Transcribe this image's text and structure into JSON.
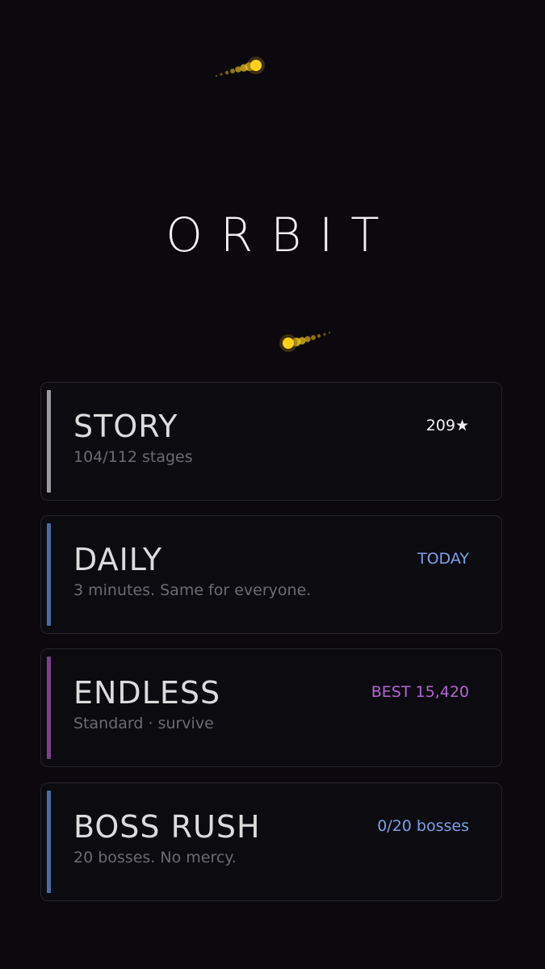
{
  "game": {
    "title": "ORBIT"
  },
  "colors": {
    "background": "#0b080e",
    "comet": "#ffd21a",
    "story_accent": "#9a9aa0",
    "daily_accent": "#4e6aa6",
    "endless_accent": "#7e3f90",
    "boss_accent": "#4e6aa6",
    "daily_stat": "#7e9fe6",
    "endless_stat": "#b464d2",
    "boss_stat": "#7e9fe6"
  },
  "modes": [
    {
      "name": "STORY",
      "description": "104/112 stages",
      "stat": "209★",
      "stat_color": "#f2f2f2",
      "accent_color": "#9a9aa0"
    },
    {
      "name": "DAILY",
      "description": "3 minutes. Same for everyone.",
      "stat": "TODAY",
      "stat_color": "#7e9fe6",
      "accent_color": "#4e6aa6"
    },
    {
      "name": "ENDLESS",
      "description": "Standard · survive",
      "stat": "BEST 15,420",
      "stat_color": "#b464d2",
      "accent_color": "#7e3f90"
    },
    {
      "name": "BOSS RUSH",
      "description": "20 bosses. No mercy.",
      "stat": "0/20 bosses",
      "stat_color": "#7e9fe6",
      "accent_color": "#4e6aa6"
    }
  ]
}
